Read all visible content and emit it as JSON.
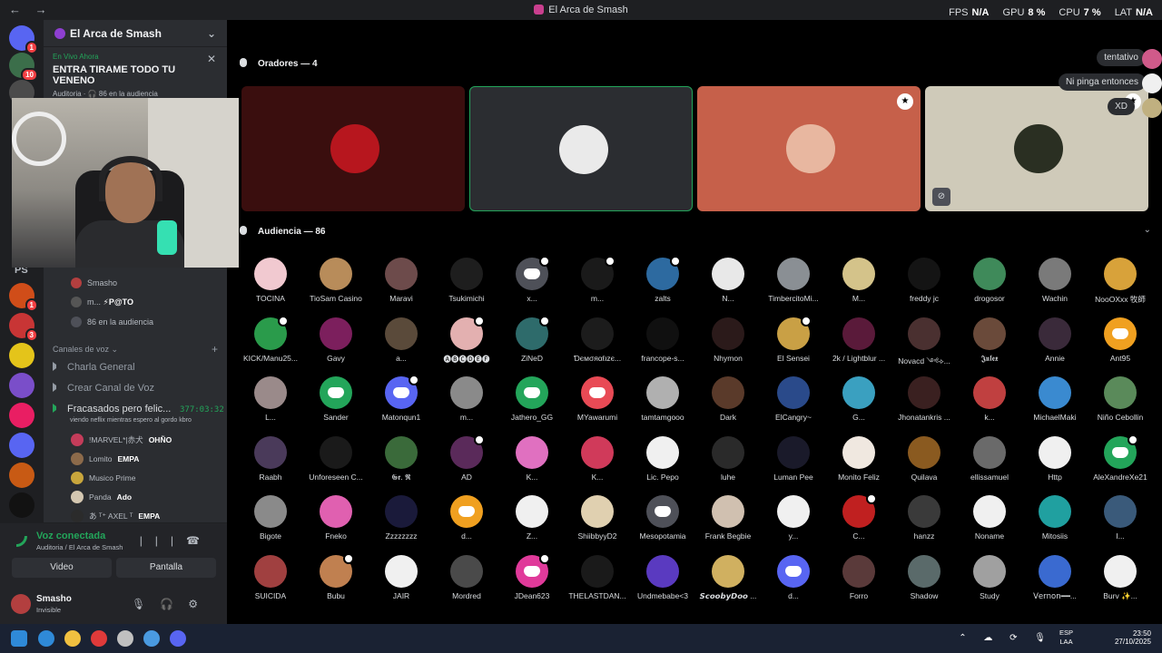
{
  "window": {
    "nav": "← →",
    "title": "El Arca de Smash"
  },
  "perf": {
    "fps_label": "FPS",
    "fps": "N/A",
    "gpu_label": "GPU",
    "gpu": "8 %",
    "cpu_label": "CPU",
    "cpu": "7 %",
    "lat_label": "LAT",
    "lat": "N/A"
  },
  "rail": [
    {
      "color": "#5865f2",
      "badge": "1"
    },
    {
      "color": "#3b6e4a",
      "badge": "10"
    },
    {
      "color": "#4b4b4b",
      "badge": ""
    },
    {
      "color": "#d04d19",
      "badge": "1"
    },
    {
      "color": "#c83535",
      "badge": "3"
    },
    {
      "color": "#e4c41a",
      "badge": ""
    },
    {
      "color": "#7a4ec9",
      "badge": ""
    },
    {
      "color": "#e91e63",
      "badge": ""
    },
    {
      "color": "#5865f2",
      "badge": ""
    },
    {
      "color": "#c85a14",
      "badge": ""
    },
    {
      "color": "#121212",
      "badge": ""
    }
  ],
  "server": {
    "name": "El Arca de Smash"
  },
  "live": {
    "label": "En Vivo Ahora",
    "name": "ENTRA TIRAME TODO TU VENENO",
    "meta": "Auditoria · 🎧 86 en la audiencia"
  },
  "sidebar_ps": "PS",
  "stage_users": [
    {
      "name": "Smasho",
      "tag": ""
    },
    {
      "name": "m...",
      "tag": "⚡P@TO"
    },
    {
      "name": "86 en la audiencia",
      "tag": ""
    }
  ],
  "voice_section": "Canales de voz",
  "channels": [
    {
      "name": "Charla General"
    },
    {
      "name": "Crear Canal de Voz"
    },
    {
      "name": "Fracasados pero felic...",
      "timer": "377:03:32"
    }
  ],
  "channel_status": "viendo neflix mientras espero al gordo kbro",
  "voice_users": [
    {
      "name": "!MARVEL*|赤犬",
      "status": "OHÑO",
      "color": "#c43c5a"
    },
    {
      "name": "Lomito",
      "status": "EMPA",
      "color": "#8c6a4a"
    },
    {
      "name": "Musico Prime",
      "status": "",
      "color": "#c9a63c"
    },
    {
      "name": "Panda",
      "status": "Ado",
      "color": "#d4c7b1"
    },
    {
      "name": "あ ᵀ⁺ AXEL ᵀ",
      "status": "EMPA",
      "color": "#2b2b2b"
    }
  ],
  "voice_panel": {
    "title": "Voz conectada",
    "sub": "Auditoria / El Arca de Smash",
    "video": "Video",
    "screen": "Pantalla"
  },
  "user": {
    "name": "Smasho",
    "status": "Invisible"
  },
  "speakers_header": "Oradores — 4",
  "speakers": [
    {
      "bg": "#3a0e0e",
      "avatar": "#b7161e",
      "mod": false,
      "muted": false
    },
    {
      "bg": "#2b2d31",
      "avatar": "#eaeaea",
      "mod": false,
      "muted": false,
      "active": true
    },
    {
      "bg": "#c6604a",
      "avatar": "#e8b7a0",
      "mod": true,
      "muted": false
    },
    {
      "bg": "#cfcab9",
      "avatar": "#2a2f22",
      "mod": true,
      "muted": true
    }
  ],
  "reactions": [
    "tentativo",
    "Ni pinga entonces",
    "XD"
  ],
  "audience_header": "Audiencia — 86",
  "audience": [
    {
      "name": "TOCINA",
      "color": "#f1c9d0"
    },
    {
      "name": "TioSam Casino",
      "color": "#b88c5a"
    },
    {
      "name": "Maravi",
      "color": "#6d4b4b"
    },
    {
      "name": "Tsukimichi",
      "color": "#1e1e1e"
    },
    {
      "name": "x...",
      "color": "#4e5058",
      "discord": true,
      "mod": true
    },
    {
      "name": "m...",
      "color": "#1a1a1a",
      "mod": true
    },
    {
      "name": "zalts",
      "color": "#2d6aa0",
      "mod": true
    },
    {
      "name": "N...",
      "color": "#e8e8e8"
    },
    {
      "name": "TimbercitoMi...",
      "color": "#8a8f94"
    },
    {
      "name": "M...",
      "color": "#d4c38a"
    },
    {
      "name": "freddy jc",
      "color": "#141414"
    },
    {
      "name": "drogosor",
      "color": "#3f8a5a"
    },
    {
      "name": "Wachin",
      "color": "#7a7a7a"
    },
    {
      "name": "NooOXxx 牧師",
      "color": "#d8a23a"
    },
    {
      "name": "KICK/Manu25...",
      "color": "#2a9b4b",
      "mod": true
    },
    {
      "name": "Gavy",
      "color": "#7c1f5d"
    },
    {
      "name": "a...",
      "color": "#5a4a3a"
    },
    {
      "name": "🅐🅑🅒🅓🅔🅕",
      "color": "#e3b0b0",
      "mod": true
    },
    {
      "name": "ZiNeD",
      "color": "#2e6b6b",
      "mod": true
    },
    {
      "name": "Ɗємσяαℓιzє...",
      "color": "#1c1c1c"
    },
    {
      "name": "francope-s...",
      "color": "#101010"
    },
    {
      "name": "Nhymon",
      "color": "#2b1a1a"
    },
    {
      "name": "El Sensei",
      "color": "#c9a045",
      "mod": true
    },
    {
      "name": "2k / Lightblur ...",
      "color": "#5a1a3a"
    },
    {
      "name": "Novacd ༺⟡...",
      "color": "#4a3030"
    },
    {
      "name": "𝕵𝖚𝖑𝖊𝖝",
      "color": "#6a4a3a"
    },
    {
      "name": "Annie",
      "color": "#3a2a3a"
    },
    {
      "name": "Ant95",
      "color": "#f0a020",
      "discord": true
    },
    {
      "name": "L...",
      "color": "#9a8a8a"
    },
    {
      "name": "Sander",
      "color": "#23a55a",
      "discord": true
    },
    {
      "name": "Matonqun1",
      "color": "#5865f2",
      "discord": true,
      "mod": true
    },
    {
      "name": "m...",
      "color": "#8a8a8a"
    },
    {
      "name": "Jathero_GG",
      "color": "#23a55a",
      "discord": true
    },
    {
      "name": "MYawarumi",
      "color": "#e84a55",
      "discord": true
    },
    {
      "name": "tamtamgooo",
      "color": "#b0b0b0"
    },
    {
      "name": "Dark",
      "color": "#5a3a2a"
    },
    {
      "name": "ElCangry~",
      "color": "#2a4a8a"
    },
    {
      "name": "G...",
      "color": "#3aa0c0"
    },
    {
      "name": "Jhonatankris ...",
      "color": "#3a2020"
    },
    {
      "name": "k...",
      "color": "#c04040"
    },
    {
      "name": "MichaelMaki",
      "color": "#3a8ad0"
    },
    {
      "name": "Niño Cebollin",
      "color": "#5a8a5a"
    },
    {
      "name": "Raabh",
      "color": "#4a3a5a"
    },
    {
      "name": "Unforeseen C...",
      "color": "#1a1a1a"
    },
    {
      "name": "𝕲𝖗. 𝕽",
      "color": "#3a6a3a"
    },
    {
      "name": "AD",
      "color": "#5a2a5a",
      "mod": true
    },
    {
      "name": "K...",
      "color": "#e070c0"
    },
    {
      "name": "K...",
      "color": "#d03a5a"
    },
    {
      "name": "Lic. Pepo",
      "color": "#f0f0f0"
    },
    {
      "name": "luhe",
      "color": "#2a2a2a"
    },
    {
      "name": "Luman Pee",
      "color": "#1a1a2a"
    },
    {
      "name": "Monito Feliz",
      "color": "#f0e8e0"
    },
    {
      "name": "Quilava",
      "color": "#8a5a20"
    },
    {
      "name": "ellissamuel",
      "color": "#6a6a6a"
    },
    {
      "name": "Http",
      "color": "#f0f0f0"
    },
    {
      "name": "AleXandreXe21",
      "color": "#23a55a",
      "discord": true,
      "mod": true
    },
    {
      "name": "Bigote",
      "color": "#8a8a8a"
    },
    {
      "name": "Fneko",
      "color": "#e060b0"
    },
    {
      "name": "Zzzzzzzz",
      "color": "#1a1a3a"
    },
    {
      "name": "d...",
      "color": "#f0a020",
      "discord": true
    },
    {
      "name": "Z...",
      "color": "#f0f0f0"
    },
    {
      "name": "ShiibbyyD2",
      "color": "#e0d0b0"
    },
    {
      "name": "Mesopotamia",
      "color": "#4e5058",
      "discord": true
    },
    {
      "name": "Frank Begbie",
      "color": "#d0c0b0"
    },
    {
      "name": "y...",
      "color": "#f0f0f0"
    },
    {
      "name": "C...",
      "color": "#c02020",
      "mod": true
    },
    {
      "name": "hanzz",
      "color": "#3a3a3a"
    },
    {
      "name": "Noname",
      "color": "#f0f0f0"
    },
    {
      "name": "Mitosiis",
      "color": "#20a0a0"
    },
    {
      "name": "I...",
      "color": "#3a5a7a"
    },
    {
      "name": "SUICIDA",
      "color": "#a04040"
    },
    {
      "name": "Bubu",
      "color": "#c08050",
      "mod": true
    },
    {
      "name": "JAIR",
      "color": "#f0f0f0"
    },
    {
      "name": "Mordred",
      "color": "#4a4a4a"
    },
    {
      "name": "JDean623",
      "color": "#e03a9a",
      "discord": true,
      "mod": true
    },
    {
      "name": "THELASTDAN...",
      "color": "#1a1a1a"
    },
    {
      "name": "Undmebabe<3",
      "color": "#5a3ac0"
    },
    {
      "name": "𝙎𝙘𝙤𝙤𝙗𝙮𝘿𝙤𝙤 ...",
      "color": "#d0b060"
    },
    {
      "name": "d...",
      "color": "#5865f2",
      "discord": true
    },
    {
      "name": "Forro",
      "color": "#5a3a3a"
    },
    {
      "name": "Shadow",
      "color": "#5a6a6a"
    },
    {
      "name": "Study",
      "color": "#a0a0a0"
    },
    {
      "name": "𝖵𝖾𝗋𝗇𝗈𝗇━━...",
      "color": "#3a6ad0"
    },
    {
      "name": "Burv ✨...",
      "color": "#f0f0f0"
    }
  ],
  "taskbar": {
    "lang1": "ESP",
    "lang2": "LAA",
    "time": "23:50",
    "date": "27/10/2025",
    "icons": [
      "#2f8ad8",
      "#f0c040",
      "#e03a3a",
      "#c0c0c0",
      "#4a9ae0",
      "#5865f2"
    ]
  }
}
